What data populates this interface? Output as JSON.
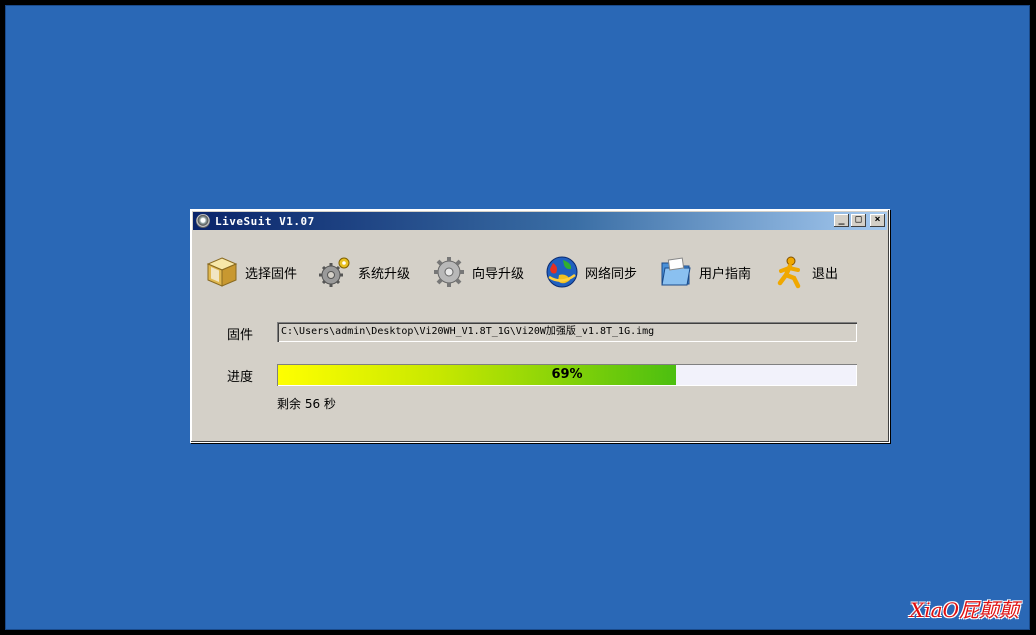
{
  "window": {
    "title": "LiveSuit V1.07",
    "minimize": "_",
    "maximize": "□",
    "close": "×"
  },
  "toolbar": {
    "items": [
      {
        "label": "选择固件",
        "icon": "box-icon"
      },
      {
        "label": "系统升级",
        "icon": "gears-icon"
      },
      {
        "label": "向导升级",
        "icon": "gear-wizard-icon"
      },
      {
        "label": "网络同步",
        "icon": "globe-icon"
      },
      {
        "label": "用户指南",
        "icon": "folder-icon"
      },
      {
        "label": "退出",
        "icon": "runner-icon"
      }
    ]
  },
  "firmware": {
    "label": "固件",
    "path": "C:\\Users\\admin\\Desktop\\Vi20WH_V1.8T_1G\\Vi20W加强版_v1.8T_1G.img"
  },
  "progress": {
    "label": "进度",
    "value": 69,
    "text": "69%",
    "remaining": "剩余 56 秒"
  },
  "watermark": "XiaO屁颠颠",
  "colors": {
    "desktop": "#2a68b6",
    "titlebar_start": "#0a246a",
    "progress_start": "#ffff00",
    "progress_end": "#4cbf10"
  }
}
